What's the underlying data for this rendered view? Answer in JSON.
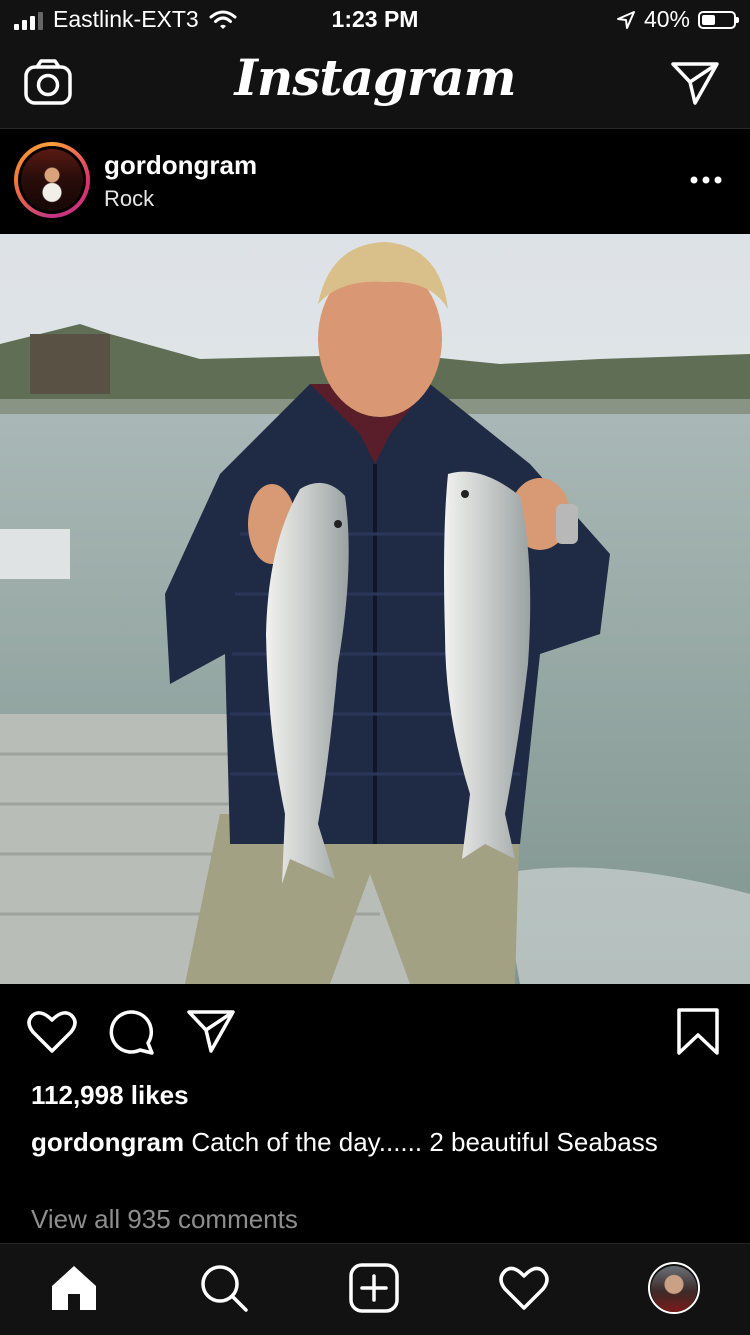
{
  "status_bar": {
    "carrier": "Eastlink-EXT3",
    "time": "1:23 PM",
    "battery_pct": "40%",
    "icons": [
      "signal-icon",
      "wifi-icon",
      "location-arrow-icon",
      "battery-icon"
    ]
  },
  "top_nav": {
    "logo_text": "Instagram",
    "left_icon": "camera-icon",
    "right_icon": "direct-message-icon"
  },
  "post": {
    "username": "gordongram",
    "location": "Rock",
    "more_icon": "more-options-icon",
    "likes_text": "112,998 likes",
    "caption_user": "gordongram",
    "caption_text": "Catch of the day...... 2 beautiful Seabass",
    "view_comments": "View all 935 comments",
    "action_icons": [
      "heart-icon",
      "comment-icon",
      "share-icon",
      "bookmark-icon"
    ]
  },
  "tab_bar": {
    "items": [
      "home-icon",
      "search-icon",
      "new-post-icon",
      "activity-heart-icon",
      "profile-avatar"
    ]
  },
  "colors": {
    "background": "#000000",
    "bar_background": "#121212",
    "muted_text": "#8e8e8e",
    "story_ring": "#e1306c"
  }
}
